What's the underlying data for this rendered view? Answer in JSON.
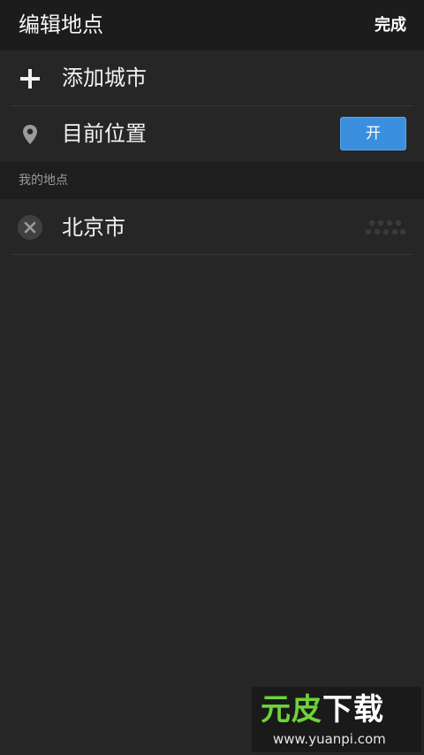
{
  "header": {
    "title": "编辑地点",
    "done_label": "完成"
  },
  "add_city": {
    "label": "添加城市",
    "icon": "plus-icon"
  },
  "current_location": {
    "label": "目前位置",
    "icon": "location-pin-icon",
    "toggle_label": "开",
    "toggle_color": "#3a8fde"
  },
  "my_places": {
    "title": "我的地点",
    "items": [
      {
        "label": "北京市",
        "remove_icon": "remove-circle-icon",
        "drag_icon": "drag-handle-icon"
      }
    ]
  },
  "watermark": {
    "logo_part1": "元皮",
    "logo_part2": "下载",
    "url": "www.yuanpi.com"
  }
}
